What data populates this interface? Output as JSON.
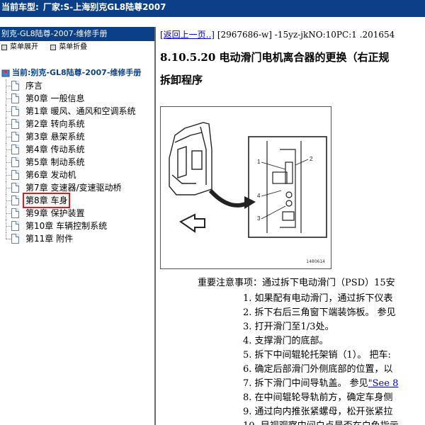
{
  "topbar": {
    "label": "当前车型:",
    "value": "厂家:S-上海别克GL8陆尊2007"
  },
  "left_panel": {
    "title": "别克-GL8陆尊-2007-维修手册",
    "toolbar": {
      "expand": "菜单展开",
      "collapse": "菜单折叠"
    },
    "tree_root": "当前:别克-GL8陆尊-2007-维修手册",
    "items": [
      {
        "label": "序言"
      },
      {
        "label": "第0章 一般信息"
      },
      {
        "label": "第1章 暖风、通风和空调系统"
      },
      {
        "label": "第2章 转向系统"
      },
      {
        "label": "第3章 悬架系统"
      },
      {
        "label": "第4章 传动系统"
      },
      {
        "label": "第5章 制动系统"
      },
      {
        "label": "第6章 发动机"
      },
      {
        "label": "第7章 变速器/变速驱动桥"
      },
      {
        "label": "第8章 车身"
      },
      {
        "label": "第9章 保护装置"
      },
      {
        "label": "第10章 车辆控制系统"
      },
      {
        "label": "第11章 附件"
      }
    ],
    "selected_index": 9
  },
  "content": {
    "back_link": "[返回上一页..]",
    "doc_info": " [2967686-w] -15yz-jkNO:10PC:1 .201654",
    "heading": "8.10.5.20 电动滑门电机离合器的更换（右正规",
    "subheading": "拆卸程序",
    "figure": {
      "code": "1480614",
      "callouts": [
        "1",
        "2",
        "3",
        "4"
      ]
    },
    "notice": "重要注意事项：通过拆下电动滑门（PSD）15安",
    "steps": [
      {
        "text": "1. 如果配有电动滑门，通过拆下仪表",
        "link": ""
      },
      {
        "text": "2. 拆下右后三角窗下端装饰板。 参见",
        "link": ""
      },
      {
        "text": "3. 打开滑门至1/3处。",
        "link": ""
      },
      {
        "text": "4. 支撑滑门的底部。",
        "link": ""
      },
      {
        "text": "5. 拆下中间辊轮托架销（1）。 把车:",
        "link": ""
      },
      {
        "text": "6. 确定后部滑门外侧底部的位置，以",
        "link": ""
      },
      {
        "text": "7. 拆下滑门中间导轨盖。 参见",
        "link": "\"See 8"
      },
      {
        "text": "8. 在中间辊轮导轨前方，确定车身侧",
        "link": ""
      },
      {
        "text": "9. 通过向内推张紧螺母，松开张紧拉",
        "link": ""
      },
      {
        "text": "10. 目视观察中间白点是否在白色指示",
        "link": ""
      }
    ]
  }
}
